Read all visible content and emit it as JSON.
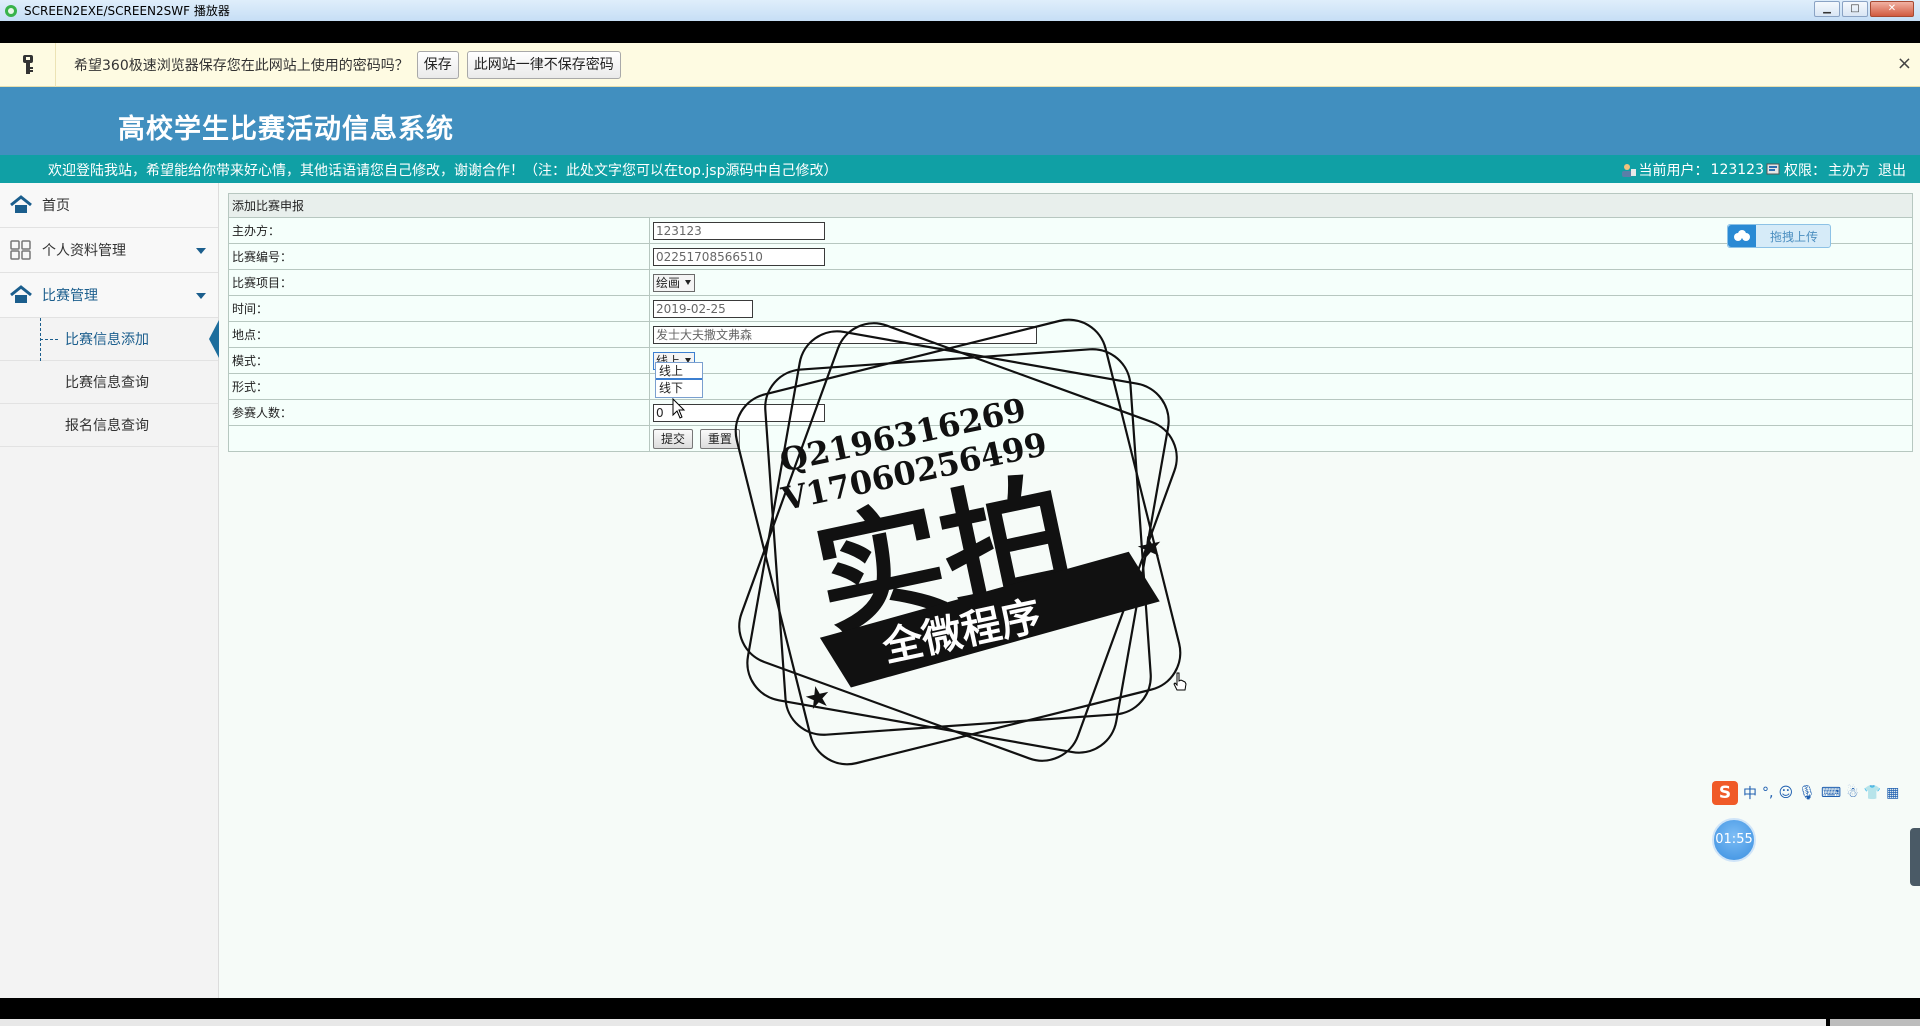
{
  "window": {
    "title": "SCREEN2EXE/SCREEN2SWF 播放器",
    "controls": [
      "minimize",
      "maximize",
      "close"
    ]
  },
  "password_bar": {
    "message": "希望360极速浏览器保存您在此网站上使用的密码吗？",
    "save_label": "保存",
    "never_label": "此网站一律不保存密码",
    "close_glyph": "×"
  },
  "header": {
    "system_title": "高校学生比赛活动信息系统"
  },
  "welcome_bar": {
    "text": "欢迎登陆我站，希望能给你带来好心情，其他话语请您自己修改，谢谢合作！（注：此处文字您可以在top.jsp源码中自己修改）",
    "current_user_label": "当前用户：",
    "current_user": "123123",
    "permission_label": "权限：",
    "permission": "主办方",
    "logout": "退出"
  },
  "upload_button": {
    "label": "拖拽上传"
  },
  "sidebar": {
    "items": [
      {
        "label": "首页",
        "icon": "home-icon"
      },
      {
        "label": "个人资料管理",
        "icon": "grid-icon"
      },
      {
        "label": "比赛管理",
        "icon": "home-icon"
      }
    ],
    "sub_items": [
      {
        "label": "比赛信息添加",
        "active": true
      },
      {
        "label": "比赛信息查询",
        "active": false
      },
      {
        "label": "报名信息查询",
        "active": false
      }
    ]
  },
  "form": {
    "caption": "添加比赛申报",
    "fields": [
      {
        "label": "主办方：",
        "value": "123123"
      },
      {
        "label": "比赛编号：",
        "value": "02251708566510"
      },
      {
        "label": "比赛项目：",
        "value": "绘画"
      },
      {
        "label": "时间：",
        "value": "2019-02-25"
      },
      {
        "label": "地点：",
        "value": "发士大夫撒文弗森"
      },
      {
        "label": "模式：",
        "value": "线上"
      },
      {
        "label": "形式：",
        "value": ""
      },
      {
        "label": "参赛人数：",
        "value": "0"
      }
    ],
    "mode_options": [
      "线上",
      "线下"
    ],
    "submit_label": "提交",
    "reset_label": "重置"
  },
  "watermark": {
    "line1": "Q2196316269",
    "line2": "V17060256499",
    "big_text": "实拍",
    "banner_text": "全微程序"
  },
  "ime": {
    "logo": "S",
    "lang": "中"
  },
  "timer": {
    "value": "01:55"
  },
  "colors": {
    "header_blue": "#418fbf",
    "welcome_teal": "#10a0a5",
    "sidebar_active": "#1b5e8d",
    "password_bar": "#fefbe2"
  }
}
